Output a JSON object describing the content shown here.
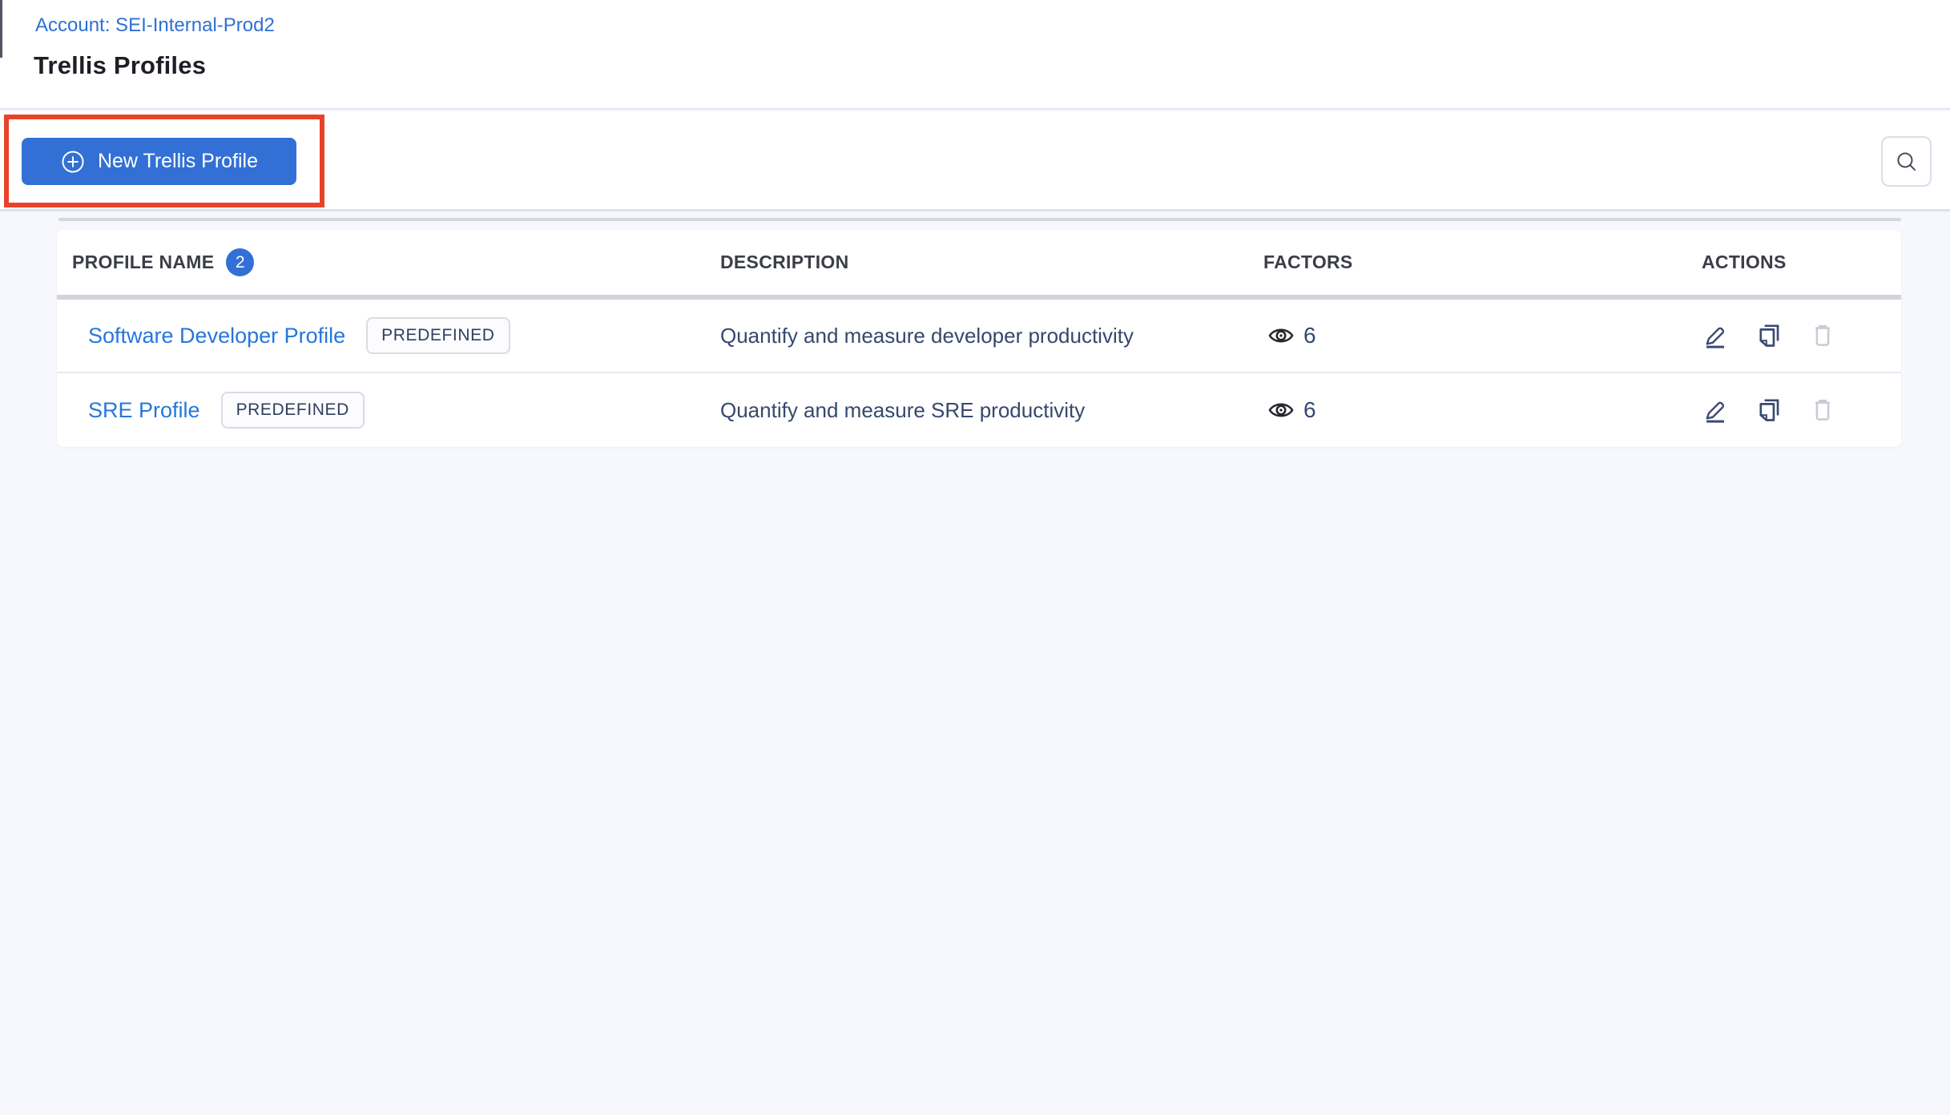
{
  "page": {
    "account_breadcrumb": "Account: SEI-Internal-Prod2",
    "title": "Trellis Profiles"
  },
  "toolbar": {
    "new_profile_button_label": "New Trellis Profile"
  },
  "icons": {
    "new_profile": "circle-plus-icon",
    "search": "magnifying-glass-icon",
    "factors": "eye-icon",
    "edit": "pencil-icon",
    "clone": "copy-pages-icon",
    "delete": "trash-icon"
  },
  "annotation": {
    "highlight_box_color": "#e8422b",
    "highlight_target": "New Trellis Profile button"
  },
  "colors": {
    "primary_button": "#3270d6",
    "link": "#2577dd",
    "count_badge": "#3270d6",
    "body_text": "#36486c",
    "header_text": "#3b3e46",
    "action_icon": "#3c4a72",
    "disabled_icon": "#c8cbd6",
    "page_background": "#f7f8fd"
  },
  "table": {
    "headers": {
      "profile_name": "PROFILE NAME",
      "profile_count": "2",
      "description": "DESCRIPTION",
      "factors": "FACTORS",
      "actions": "ACTIONS"
    },
    "rows": [
      {
        "name": "Software Developer Profile",
        "tag": "PREDEFINED",
        "description": "Quantify and measure developer productivity",
        "factors_count": "6"
      },
      {
        "name": "SRE Profile",
        "tag": "PREDEFINED",
        "description": "Quantify and measure SRE productivity",
        "factors_count": "6"
      }
    ]
  }
}
